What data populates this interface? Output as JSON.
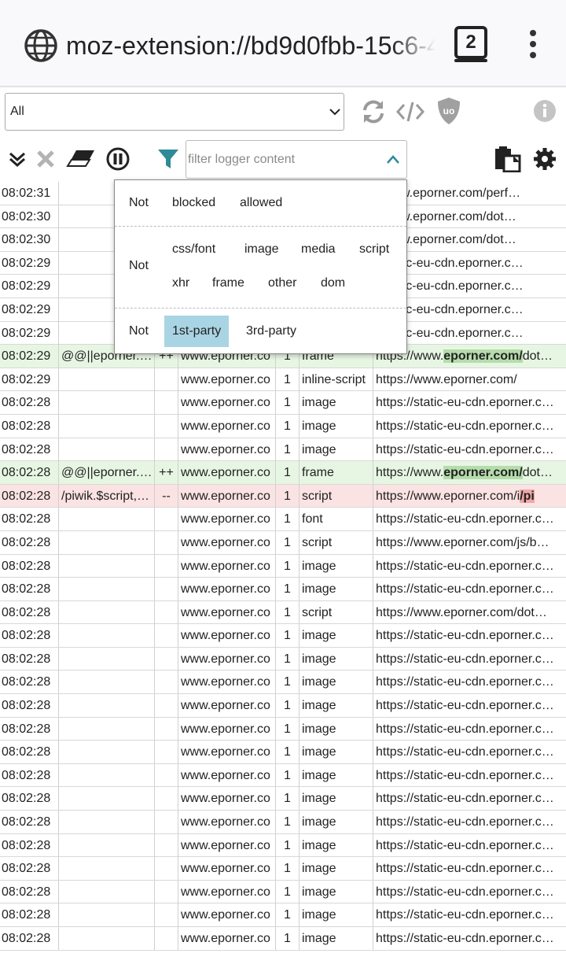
{
  "browser": {
    "url": "moz-extension://bd9d0fbb-15c6-4",
    "tab_count": "2"
  },
  "toolbar": {
    "tab_selector_value": "All",
    "filter_placeholder": "filter logger content"
  },
  "popup": {
    "row1": {
      "not": "Not",
      "options": [
        "blocked",
        "allowed"
      ]
    },
    "row2": {
      "not": "Not",
      "options": [
        "css/font",
        "image",
        "media",
        "script",
        "xhr",
        "frame",
        "other",
        "dom"
      ]
    },
    "row3": {
      "not": "Not",
      "options": [
        "1st-party",
        "3rd-party"
      ],
      "active": "1st-party"
    }
  },
  "log": [
    {
      "time": "08:02:31",
      "filter": "",
      "res": "",
      "ctx": "",
      "party": "",
      "type": "",
      "url": "//www.eporner.com/perf…",
      "status": "none"
    },
    {
      "time": "08:02:30",
      "filter": "",
      "res": "",
      "ctx": "",
      "party": "",
      "type": "",
      "url": "//www.eporner.com/dot…",
      "status": "none"
    },
    {
      "time": "08:02:30",
      "filter": "",
      "res": "",
      "ctx": "",
      "party": "",
      "type": "",
      "url": "//www.eporner.com/dot…",
      "status": "none"
    },
    {
      "time": "08:02:29",
      "filter": "",
      "res": "",
      "ctx": "",
      "party": "",
      "type": "",
      "url": "//static-eu-cdn.eporner.c…",
      "status": "none"
    },
    {
      "time": "08:02:29",
      "filter": "",
      "res": "",
      "ctx": "",
      "party": "",
      "type": "",
      "url": "//static-eu-cdn.eporner.c…",
      "status": "none"
    },
    {
      "time": "08:02:29",
      "filter": "",
      "res": "",
      "ctx": "",
      "party": "",
      "type": "",
      "url": "//static-eu-cdn.eporner.c…",
      "status": "none"
    },
    {
      "time": "08:02:29",
      "filter": "",
      "res": "",
      "ctx": "",
      "party": "",
      "type": "",
      "url": "//static-eu-cdn.eporner.c…",
      "status": "none"
    },
    {
      "time": "08:02:29",
      "filter": "@@||eporner.…",
      "res": "++",
      "ctx": "www.eporner.co",
      "party": "1",
      "type": "frame",
      "url_pre": "https://www.",
      "url_hl": "eporner.com/",
      "url_post": "dot…",
      "status": "allowed"
    },
    {
      "time": "08:02:29",
      "filter": "",
      "res": "",
      "ctx": "www.eporner.co",
      "party": "1",
      "type": "inline-script",
      "url": "https://www.eporner.com/",
      "status": "none"
    },
    {
      "time": "08:02:28",
      "filter": "",
      "res": "",
      "ctx": "www.eporner.co",
      "party": "1",
      "type": "image",
      "url": "https://static-eu-cdn.eporner.c…",
      "status": "none"
    },
    {
      "time": "08:02:28",
      "filter": "",
      "res": "",
      "ctx": "www.eporner.co",
      "party": "1",
      "type": "image",
      "url": "https://static-eu-cdn.eporner.c…",
      "status": "none"
    },
    {
      "time": "08:02:28",
      "filter": "",
      "res": "",
      "ctx": "www.eporner.co",
      "party": "1",
      "type": "image",
      "url": "https://static-eu-cdn.eporner.c…",
      "status": "none"
    },
    {
      "time": "08:02:28",
      "filter": "@@||eporner.…",
      "res": "++",
      "ctx": "www.eporner.co",
      "party": "1",
      "type": "frame",
      "url_pre": "https://www.",
      "url_hl": "eporner.com/",
      "url_post": "dot…",
      "status": "allowed"
    },
    {
      "time": "08:02:28",
      "filter": "/piwik.$script,…",
      "res": "--",
      "ctx": "www.eporner.co",
      "party": "1",
      "type": "script",
      "url_pre": "https://www.eporner.com/i",
      "url_hl": "/pi",
      "url_post": "",
      "status": "blocked"
    },
    {
      "time": "08:02:28",
      "filter": "",
      "res": "",
      "ctx": "www.eporner.co",
      "party": "1",
      "type": "font",
      "url": "https://static-eu-cdn.eporner.c…",
      "status": "none"
    },
    {
      "time": "08:02:28",
      "filter": "",
      "res": "",
      "ctx": "www.eporner.co",
      "party": "1",
      "type": "script",
      "url": "https://www.eporner.com/js/b…",
      "status": "none"
    },
    {
      "time": "08:02:28",
      "filter": "",
      "res": "",
      "ctx": "www.eporner.co",
      "party": "1",
      "type": "image",
      "url": "https://static-eu-cdn.eporner.c…",
      "status": "none"
    },
    {
      "time": "08:02:28",
      "filter": "",
      "res": "",
      "ctx": "www.eporner.co",
      "party": "1",
      "type": "image",
      "url": "https://static-eu-cdn.eporner.c…",
      "status": "none"
    },
    {
      "time": "08:02:28",
      "filter": "",
      "res": "",
      "ctx": "www.eporner.co",
      "party": "1",
      "type": "script",
      "url": "https://www.eporner.com/dot…",
      "status": "none"
    },
    {
      "time": "08:02:28",
      "filter": "",
      "res": "",
      "ctx": "www.eporner.co",
      "party": "1",
      "type": "image",
      "url": "https://static-eu-cdn.eporner.c…",
      "status": "none"
    },
    {
      "time": "08:02:28",
      "filter": "",
      "res": "",
      "ctx": "www.eporner.co",
      "party": "1",
      "type": "image",
      "url": "https://static-eu-cdn.eporner.c…",
      "status": "none"
    },
    {
      "time": "08:02:28",
      "filter": "",
      "res": "",
      "ctx": "www.eporner.co",
      "party": "1",
      "type": "image",
      "url": "https://static-eu-cdn.eporner.c…",
      "status": "none"
    },
    {
      "time": "08:02:28",
      "filter": "",
      "res": "",
      "ctx": "www.eporner.co",
      "party": "1",
      "type": "image",
      "url": "https://static-eu-cdn.eporner.c…",
      "status": "none"
    },
    {
      "time": "08:02:28",
      "filter": "",
      "res": "",
      "ctx": "www.eporner.co",
      "party": "1",
      "type": "image",
      "url": "https://static-eu-cdn.eporner.c…",
      "status": "none"
    },
    {
      "time": "08:02:28",
      "filter": "",
      "res": "",
      "ctx": "www.eporner.co",
      "party": "1",
      "type": "image",
      "url": "https://static-eu-cdn.eporner.c…",
      "status": "none"
    },
    {
      "time": "08:02:28",
      "filter": "",
      "res": "",
      "ctx": "www.eporner.co",
      "party": "1",
      "type": "image",
      "url": "https://static-eu-cdn.eporner.c…",
      "status": "none"
    },
    {
      "time": "08:02:28",
      "filter": "",
      "res": "",
      "ctx": "www.eporner.co",
      "party": "1",
      "type": "image",
      "url": "https://static-eu-cdn.eporner.c…",
      "status": "none"
    },
    {
      "time": "08:02:28",
      "filter": "",
      "res": "",
      "ctx": "www.eporner.co",
      "party": "1",
      "type": "image",
      "url": "https://static-eu-cdn.eporner.c…",
      "status": "none"
    },
    {
      "time": "08:02:28",
      "filter": "",
      "res": "",
      "ctx": "www.eporner.co",
      "party": "1",
      "type": "image",
      "url": "https://static-eu-cdn.eporner.c…",
      "status": "none"
    },
    {
      "time": "08:02:28",
      "filter": "",
      "res": "",
      "ctx": "www.eporner.co",
      "party": "1",
      "type": "image",
      "url": "https://static-eu-cdn.eporner.c…",
      "status": "none"
    },
    {
      "time": "08:02:28",
      "filter": "",
      "res": "",
      "ctx": "www.eporner.co",
      "party": "1",
      "type": "image",
      "url": "https://static-eu-cdn.eporner.c…",
      "status": "none"
    },
    {
      "time": "08:02:28",
      "filter": "",
      "res": "",
      "ctx": "www.eporner.co",
      "party": "1",
      "type": "image",
      "url": "https://static-eu-cdn.eporner.c…",
      "status": "none"
    },
    {
      "time": "08:02:28",
      "filter": "",
      "res": "",
      "ctx": "www.eporner.co",
      "party": "1",
      "type": "image",
      "url": "https://static-eu-cdn.eporner.c…",
      "status": "none"
    }
  ]
}
